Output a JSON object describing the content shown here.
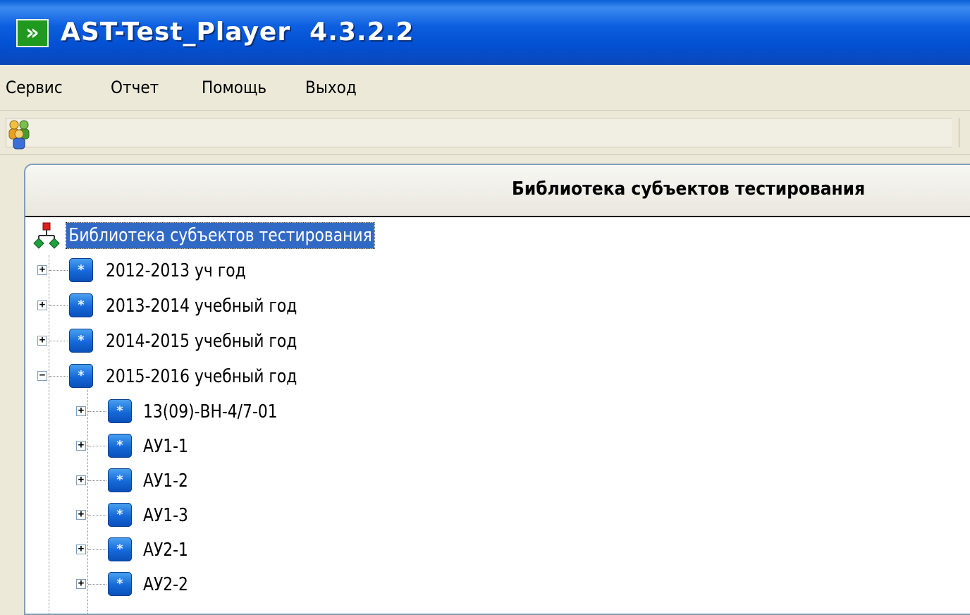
{
  "window": {
    "title": "AST-Test_Player  4.3.2.2",
    "app_icon_glyph": "»"
  },
  "menu": {
    "items": [
      "Сервис",
      "Отчет",
      "Помощь",
      "Выход"
    ]
  },
  "toolbar": {
    "users_icon": "users-icon"
  },
  "panel": {
    "header_title": "Библиотека субъектов тестирования"
  },
  "tree": {
    "root": {
      "label": "Библиотека субъектов тестирования",
      "icon": "hierarchy-icon",
      "selected": true
    },
    "years": [
      {
        "label": "2012-2013 уч год",
        "expanded": false
      },
      {
        "label": "2013-2014 учебный год",
        "expanded": false
      },
      {
        "label": "2014-2015 учебный год",
        "expanded": false
      },
      {
        "label": "2015-2016 учебный год",
        "expanded": true
      }
    ],
    "groups": [
      {
        "label": "13(09)-ВН-4/7-01",
        "expanded": false
      },
      {
        "label": "АУ1-1",
        "expanded": false
      },
      {
        "label": "АУ1-2",
        "expanded": false
      },
      {
        "label": "АУ1-3",
        "expanded": false
      },
      {
        "label": "АУ2-1",
        "expanded": false
      },
      {
        "label": "АУ2-2",
        "expanded": false
      }
    ],
    "expander_collapsed": "+",
    "expander_expanded": "−",
    "folder_glyph": "*"
  },
  "colors": {
    "titlebar": "#0350d2",
    "selection": "#316ac5",
    "folder": "#1568d8",
    "chrome": "#ece9d8"
  }
}
